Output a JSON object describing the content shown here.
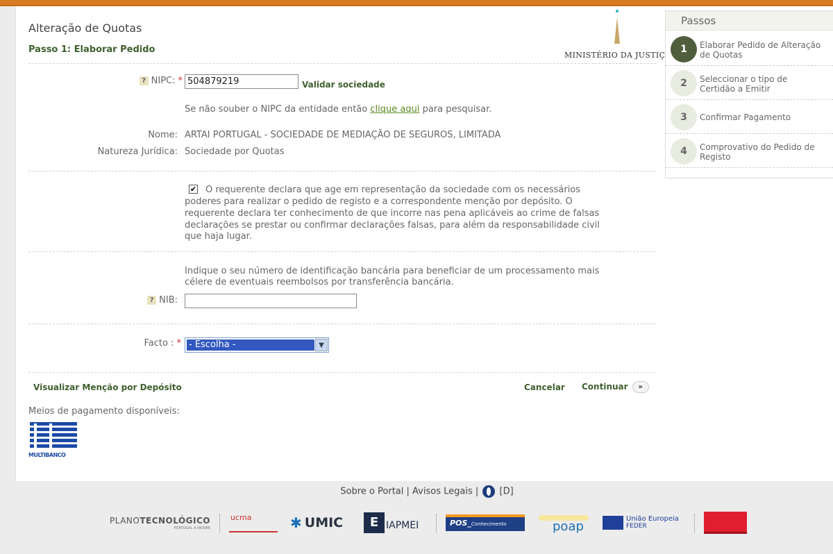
{
  "page": {
    "title": "Alteração de Quotas",
    "step_title": "Passo 1: Elaborar Pedido"
  },
  "ministry": {
    "name": "MINISTÉRIO DA JUSTIÇA"
  },
  "form": {
    "nipc_label": "NIPC:",
    "nipc_value": "504879219",
    "validate_label": "Validar sociedade",
    "nipc_hint_before": "Se não souber o NIPC da entidade então",
    "nipc_hint_link": "clique aqui",
    "nipc_hint_after": "para pesquisar.",
    "nome_label": "Nome:",
    "nome_value": "ARTAI PORTUGAL - SOCIEDADE DE MEDIAÇÃO DE SEGUROS, LIMITADA",
    "natureza_label": "Natureza Jurídica:",
    "natureza_value": "Sociedade por Quotas",
    "declaration_lines": [
      "O requerente declara que age em representação da sociedade com os necessários",
      "poderes para realizar o pedido de registo e a correspondente menção por depósito. O",
      "requerente declara ter conhecimento de que incorre nas pena aplicáveis ao crime de falsas",
      "declarações se prestar ou confirmar declarações falsas, para além da responsabilidade civil",
      "que haja lugar."
    ],
    "declaration_checked": true,
    "nib_hint_lines": [
      "Indique o seu número de identificação bancária para beneficiar de um processamento mais",
      "célere de eventuais reembolsos por transferência bancária."
    ],
    "nib_label": "NIB:",
    "nib_value": "",
    "facto_label": "Facto :",
    "facto_value": "- Escolha -",
    "required_mark": "*",
    "help_mark": "?"
  },
  "actions": {
    "view_mention": "Visualizar Menção por Depósito",
    "cancel": "Cancelar",
    "continue": "Continuar",
    "continue_icon": "»"
  },
  "payment": {
    "label": "Meios de pagamento disponíveis:",
    "logo_text": "MULTIBANCO"
  },
  "steps_panel": {
    "title": "Passos",
    "items": [
      {
        "num": "1",
        "lines": [
          "Elaborar Pedido de Alteração",
          "de Quotas"
        ],
        "active": true
      },
      {
        "num": "2",
        "lines": [
          "Seleccionar o tipo de",
          "Certidão a Emitir"
        ],
        "active": false
      },
      {
        "num": "3",
        "lines": [
          "Confirmar Pagamento"
        ],
        "active": false
      },
      {
        "num": "4",
        "lines": [
          "Comprovativo do Pedido de",
          "Registo"
        ],
        "active": false
      }
    ]
  },
  "footer": {
    "about": "Sobre o Portal",
    "legal": "Avisos Legais",
    "d_link": "[D]",
    "sep": "|",
    "sponsors": {
      "plano_a": "PLANO",
      "plano_b": "TECNOLÓGICO",
      "plano_sub": "PORTUGAL A INOVAR",
      "ucma": "ucma",
      "umic": "UMIC",
      "iapmei": "IAPMEI",
      "pos_a": "POS_",
      "pos_b": "Conhecimento",
      "poap": "poap",
      "ue_a": "União Europeia",
      "ue_b": "FEDER"
    }
  }
}
